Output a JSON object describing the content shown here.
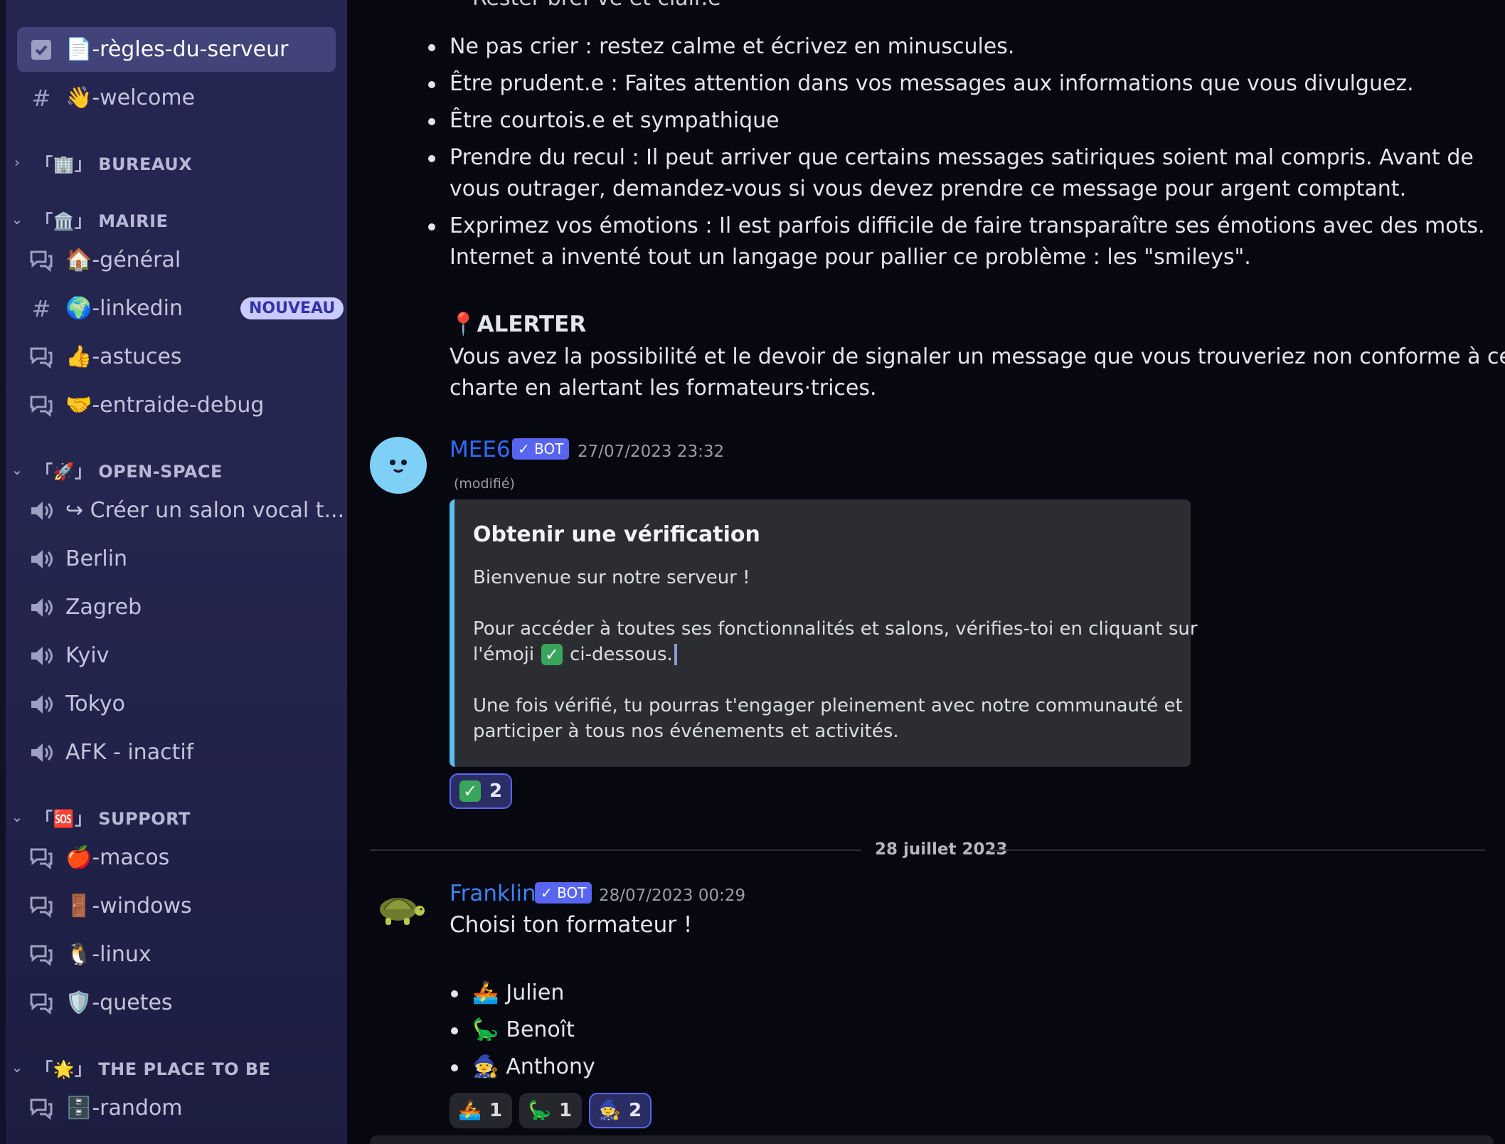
{
  "sidebar": {
    "channels_top": [
      {
        "label": "📄-règles-du-serveur",
        "icon": "rules-channel-icon",
        "selected": true
      },
      {
        "label": "👋-welcome",
        "icon": "hash-icon",
        "selected": false
      }
    ],
    "categories": {
      "bureaux": {
        "label": "「🏢」 BUREAUX",
        "collapsed": true
      },
      "mairie": {
        "label": "「🏛️」 MAIRIE"
      },
      "open_space": {
        "label": "「🚀」 OPEN-SPACE"
      },
      "support": {
        "label": "「🆘」 SUPPORT"
      },
      "place": {
        "label": "「🌟」 THE PLACE TO BE"
      }
    },
    "mairie_channels": [
      {
        "label": "🏠-général",
        "icon": "forum-icon"
      },
      {
        "label": "🌍-linkedin",
        "icon": "hash-icon",
        "badge": "NOUVEAU"
      },
      {
        "label": "👍-astuces",
        "icon": "forum-icon"
      },
      {
        "label": "🤝-entraide-debug",
        "icon": "forum-icon"
      }
    ],
    "open_space_channels": [
      {
        "label": "↪ Créer un salon vocal t...",
        "icon": "speaker-icon"
      },
      {
        "label": "Berlin",
        "icon": "speaker-icon"
      },
      {
        "label": "Zagreb",
        "icon": "speaker-icon"
      },
      {
        "label": "Kyiv",
        "icon": "speaker-icon"
      },
      {
        "label": "Tokyo",
        "icon": "speaker-icon"
      },
      {
        "label": "AFK - inactif",
        "icon": "speaker-icon"
      }
    ],
    "support_channels": [
      {
        "label": "🍎-macos",
        "icon": "forum-icon"
      },
      {
        "label": "🚪-windows",
        "icon": "forum-icon"
      },
      {
        "label": "🐧-linux",
        "icon": "forum-icon"
      },
      {
        "label": "🛡️-quetes",
        "icon": "forum-icon"
      }
    ],
    "place_channels": [
      {
        "label": "🗄️-random",
        "icon": "forum-icon"
      }
    ]
  },
  "rules": {
    "cut_line": "Rester bref ve et clair.e",
    "bullets": [
      {
        "lines": [
          "Ne pas crier : restez calme et écrivez en minuscules."
        ]
      },
      {
        "lines": [
          "Être prudent.e : Faites attention dans vos messages aux informations que vous divulguez."
        ]
      },
      {
        "lines": [
          "Être courtois.e et sympathique"
        ]
      },
      {
        "lines": [
          "Prendre du recul : Il peut arriver que certains messages satiriques soient mal compris. Avant de",
          "vous outrager, demandez-vous si vous devez prendre ce message pour argent comptant."
        ]
      },
      {
        "lines": [
          "Exprimez vos émotions : Il est parfois difficile de faire transparaître ses émotions avec des mots.",
          "Internet a inventé tout un langage pour pallier ce problème : les \"smileys\"."
        ]
      }
    ],
    "alert_title": "📍ALERTER",
    "alert_lines": [
      "Vous avez la possibilité et le devoir de signaler un message que vous trouveriez non conforme à cette",
      "charte en alertant les formateurs·trices."
    ]
  },
  "mee6": {
    "author": "MEE6",
    "author_color": "#2f6bff",
    "bot_tag": "✓ BOT",
    "timestamp": "27/07/2023 23:32",
    "edited": "(modifié)",
    "embed": {
      "title": "Obtenir une vérification",
      "p1": "Bienvenue sur notre serveur !",
      "p2a": "Pour accéder à toutes ses fonctionnalités et salons, vérifies-toi en cliquant sur",
      "p2b_pre": "l'émoji",
      "p2b_post": "ci-dessous.",
      "p3a": "Une fois vérifié, tu pourras t'engager pleinement avec notre communauté et",
      "p3b": "participer à tous nos événements et activités.",
      "accent": "#5bbdf0"
    },
    "reaction": {
      "emoji": "✅",
      "count": "2"
    }
  },
  "date_separator": "28 juillet 2023",
  "franklin": {
    "author": "Franklin",
    "author_color": "#3b82f6",
    "bot_tag": "✓ BOT",
    "timestamp": "28/07/2023 00:29",
    "text": "Choisi ton formateur !",
    "choices": [
      {
        "emoji": "🚣",
        "name": "Julien"
      },
      {
        "emoji": "🦕",
        "name": "Benoît"
      },
      {
        "emoji": "🧙",
        "name": "Anthony"
      }
    ],
    "reactions": [
      {
        "emoji": "🚣",
        "count": "1",
        "active": false
      },
      {
        "emoji": "🦕",
        "count": "1",
        "active": false
      },
      {
        "emoji": "🧙",
        "count": "2",
        "active": true
      }
    ]
  }
}
